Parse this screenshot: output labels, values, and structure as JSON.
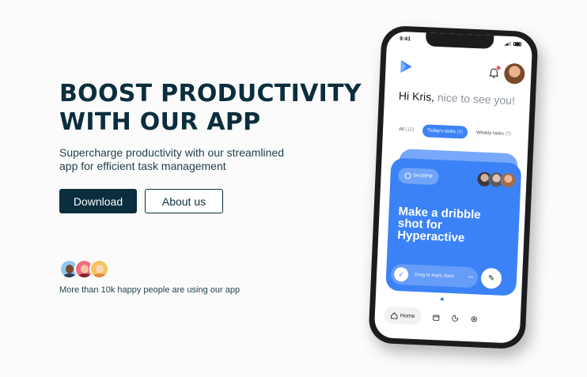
{
  "hero": {
    "headline_line1": "BOOST PRODUCTIVITY",
    "headline_line2": "WITH OUR APP",
    "subtitle": "Supercharge productivity with our streamlined app for efficient task management",
    "download_label": "Download",
    "about_label": "About us"
  },
  "social": {
    "text": "More than 10k happy people are using our app"
  },
  "phone": {
    "status_time": "9:41",
    "greeting_name": "Hi Kris,",
    "greeting_rest": "nice to see you!",
    "tabs": [
      {
        "label": "All",
        "count": "(12)"
      },
      {
        "label": "Today's tasks",
        "count": "(5)"
      },
      {
        "label": "Weekly tasks",
        "count": "(7)"
      }
    ],
    "card": {
      "time": "04:00PM",
      "title": "Make a dribble shot for Hyperactive",
      "drag_text": "Drag to mark done",
      "chevrons": "›››"
    },
    "nav": {
      "home_label": "Home"
    }
  },
  "colors": {
    "brand_dark": "#0b2e3e",
    "accent_blue": "#3b82f6"
  },
  "icons": [
    "app-logo-icon",
    "bell-icon",
    "clock-icon",
    "check-icon",
    "edit-icon",
    "home-icon",
    "calendar-icon",
    "chart-icon",
    "settings-icon"
  ]
}
